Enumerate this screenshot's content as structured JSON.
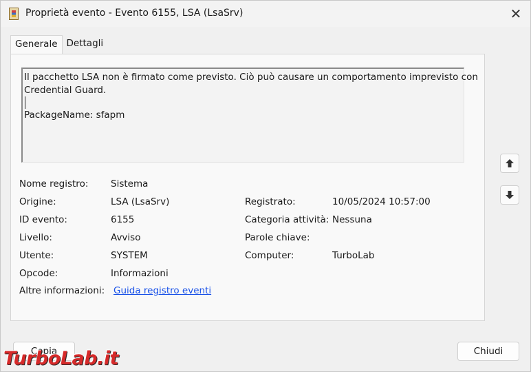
{
  "window": {
    "title": "Proprietà evento - Evento 6155, LSA (LsaSrv)",
    "close_icon": "close-icon"
  },
  "tabs": [
    {
      "label": "Generale",
      "active": true
    },
    {
      "label": "Dettagli",
      "active": false
    }
  ],
  "description": {
    "line1": "Il pacchetto LSA non è firmato come previsto. Ciò può causare un comportamento imprevisto con",
    "line2": "Credential Guard.",
    "line3": "PackageName: sfapm"
  },
  "fields": {
    "nome_registro": {
      "label": "Nome registro:",
      "value": "Sistema"
    },
    "origine": {
      "label": "Origine:",
      "value": "LSA (LsaSrv)"
    },
    "registrato": {
      "label": "Registrato:",
      "value": "10/05/2024 10:57:00"
    },
    "id_evento": {
      "label": "ID evento:",
      "value": "6155"
    },
    "categoria": {
      "label": "Categoria attività:",
      "value": "Nessuna"
    },
    "livello": {
      "label": "Livello:",
      "value": "Avviso"
    },
    "parole_chiave": {
      "label": "Parole chiave:",
      "value": ""
    },
    "utente": {
      "label": "Utente:",
      "value": "SYSTEM"
    },
    "computer": {
      "label": "Computer:",
      "value": "TurboLab"
    },
    "opcode": {
      "label": "Opcode:",
      "value": "Informazioni"
    },
    "altre_info": {
      "label": "Altre informazioni:",
      "link": "Guida registro eventi"
    }
  },
  "nav": {
    "up_icon": "arrow-up-icon",
    "down_icon": "arrow-down-icon"
  },
  "buttons": {
    "copy": "Copia",
    "close": "Chiudi"
  },
  "watermark": {
    "text": "TurboLab.it"
  },
  "colors": {
    "link": "#1a52e8",
    "watermark": "#d62a2a"
  }
}
